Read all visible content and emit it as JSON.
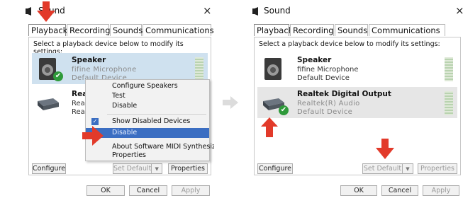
{
  "left": {
    "title": "Sound",
    "close": "×",
    "tabs": [
      "Playback",
      "Recording",
      "Sounds",
      "Communications"
    ],
    "instruction": "Select a playback device below to modify its settings:",
    "devices": [
      {
        "name": "Speaker",
        "line1": "fifine Microphone",
        "line2": "Default Device"
      },
      {
        "name": "Realtek",
        "line1": "Realtek",
        "line2": "Ready"
      }
    ],
    "context_menu": [
      "Configure Speakers",
      "Test",
      "Disable",
      "Show Disabled Devices",
      "Disable",
      "About Software MIDI Synthesizer",
      "Properties"
    ],
    "buttons": {
      "configure": "Configure",
      "set_default": "Set Default",
      "properties": "Properties",
      "ok": "OK",
      "cancel": "Cancel",
      "apply": "Apply"
    }
  },
  "right": {
    "title": "Sound",
    "close": "×",
    "tabs": [
      "Playback",
      "Recording",
      "Sounds",
      "Communications"
    ],
    "instruction": "Select a playback device below to modify its settings:",
    "devices": [
      {
        "name": "Speaker",
        "line1": "fifine Microphone",
        "line2": "Default Device"
      },
      {
        "name": "Realtek Digital Output",
        "line1": "Realtek(R) Audio",
        "line2": "Default Device"
      }
    ],
    "buttons": {
      "configure": "Configure",
      "set_default": "Set Default",
      "properties": "Properties",
      "ok": "OK",
      "cancel": "Cancel",
      "apply": "Apply"
    }
  },
  "colors": {
    "selection": "#cfe1ef",
    "menu_highlight": "#3b6ec2",
    "arrow": "#e23a2a",
    "check": "#2e9a3a"
  }
}
